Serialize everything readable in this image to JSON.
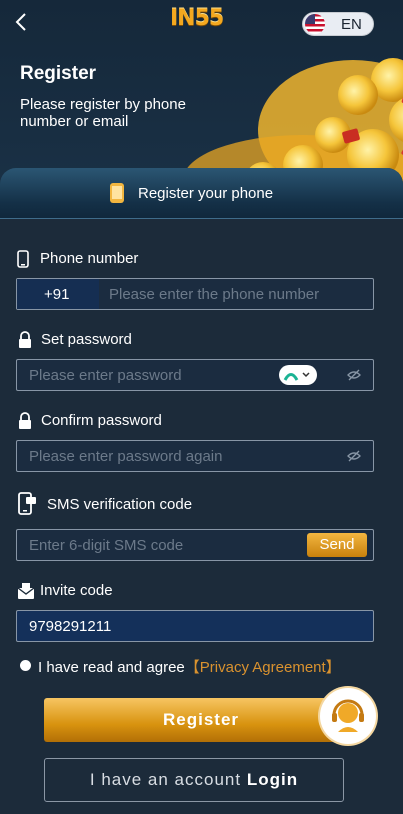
{
  "header": {
    "logo": "IN55",
    "language": "EN",
    "title": "Register",
    "subtitle": "Please register by phone number or email"
  },
  "tab": {
    "label": "Register your phone"
  },
  "form": {
    "phone": {
      "label": "Phone number",
      "country_code": "+91",
      "placeholder": "Please enter the phone number"
    },
    "password": {
      "label": "Set password",
      "placeholder": "Please enter password"
    },
    "confirm": {
      "label": "Confirm password",
      "placeholder": "Please enter password again"
    },
    "sms": {
      "label": "SMS verification code",
      "placeholder": "Enter 6-digit SMS code",
      "button": "Send"
    },
    "invite": {
      "label": "Invite code",
      "value": "9798291211"
    },
    "agree_text": "I have read and agree",
    "agree_link": "【Privacy Agreement】"
  },
  "actions": {
    "register": "Register",
    "have_account": "I have an account",
    "login": "Login"
  },
  "colors": {
    "accent": "#d9922f",
    "panel": "#1c2b3a",
    "input_border": "#8896a6"
  }
}
